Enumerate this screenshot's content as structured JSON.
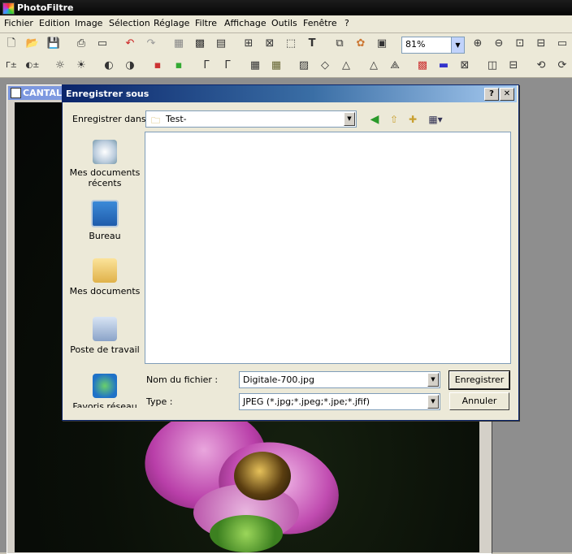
{
  "app": {
    "title": "PhotoFiltre"
  },
  "menu": [
    "Fichier",
    "Edition",
    "Image",
    "Sélection",
    "Réglage",
    "Filtre",
    "Affichage",
    "Outils",
    "Fenêtre",
    "?"
  ],
  "toolbar": {
    "zoom_value": "81%"
  },
  "document": {
    "title": "CANTAL-"
  },
  "dialog": {
    "title": "Enregistrer sous",
    "help_glyph": "?",
    "close_glyph": "✕",
    "save_in_label": "Enregistrer dans :",
    "folder": "Test-",
    "places": [
      "Mes documents récents",
      "Bureau",
      "Mes documents",
      "Poste de travail",
      "Favoris réseau"
    ],
    "filename_label": "Nom du fichier :",
    "filename_value": "Digitale-700.jpg",
    "type_label": "Type :",
    "type_value": "JPEG (*.jpg;*.jpeg;*.jpe;*.jfif)",
    "save_button": "Enregistrer",
    "cancel_button": "Annuler"
  },
  "colors": {
    "title_dark": "#0a246a",
    "title_light": "#a6caf0",
    "flower": "#c64bbf"
  }
}
